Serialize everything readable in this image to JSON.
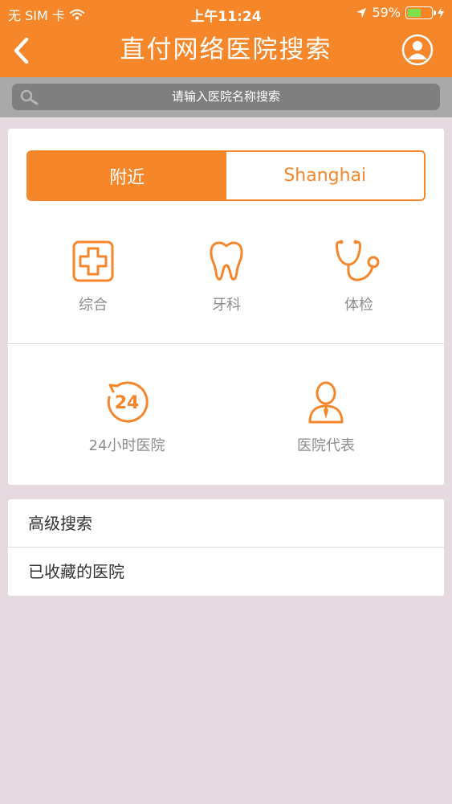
{
  "status_bar": {
    "carrier": "无 SIM 卡",
    "time": "上午11:24",
    "battery_percent": "59%",
    "battery_level": 0.59
  },
  "nav": {
    "title": "直付网络医院搜索"
  },
  "search": {
    "placeholder": "请输入医院名称搜索"
  },
  "segments": [
    {
      "label": "附近",
      "selected": true
    },
    {
      "label": "Shanghai",
      "selected": false
    }
  ],
  "categories_row1": [
    {
      "label": "综合",
      "icon": "medical-cross-icon"
    },
    {
      "label": "牙科",
      "icon": "tooth-icon"
    },
    {
      "label": "体检",
      "icon": "stethoscope-icon"
    }
  ],
  "categories_row2": [
    {
      "label": "24小时医院",
      "icon": "24-hour-icon",
      "icon_text": "24"
    },
    {
      "label": "医院代表",
      "icon": "representative-icon"
    }
  ],
  "list": [
    {
      "label": "高级搜索"
    },
    {
      "label": "已收藏的医院"
    }
  ],
  "colors": {
    "accent": "#f5862a",
    "background": "#e6d9e0",
    "search_bar": "#a9a9a9",
    "search_field": "#7f7f7f"
  }
}
